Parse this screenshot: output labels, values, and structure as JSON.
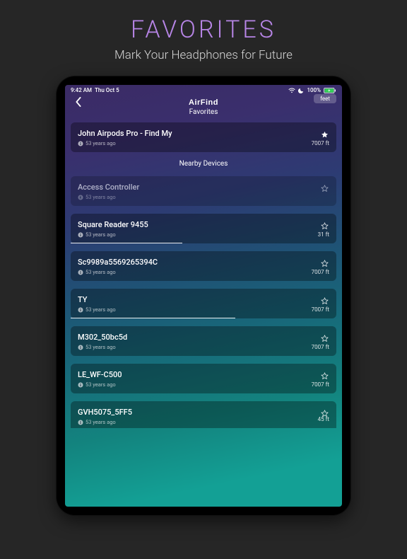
{
  "promo": {
    "title": "FAVORITES",
    "subtitle": "Mark Your Headphones for Future"
  },
  "status_bar": {
    "time": "9:42 AM",
    "date": "Thu Oct 5",
    "battery_pct": "100%"
  },
  "header": {
    "app_name": "AirFind",
    "page_title": "Favorites",
    "unit_toggle": "feet"
  },
  "favorites": [
    {
      "name": "John Airpods Pro - Find My",
      "ago": "53 years ago",
      "distance": "7007 ft",
      "starred": true,
      "progress_pct": 0
    }
  ],
  "nearby_label": "Nearby Devices",
  "nearby": [
    {
      "name": "Access Controller",
      "ago": "53 years ago",
      "distance": "",
      "starred": false,
      "dim": true,
      "progress_pct": 0
    },
    {
      "name": "Square Reader 9455",
      "ago": "53 years ago",
      "distance": "31 ft",
      "starred": false,
      "dim": false,
      "progress_pct": 42
    },
    {
      "name": "Sc9989a5569265394C",
      "ago": "53 years ago",
      "distance": "7007 ft",
      "starred": false,
      "dim": false,
      "progress_pct": 0
    },
    {
      "name": "TY",
      "ago": "53 years ago",
      "distance": "7007 ft",
      "starred": false,
      "dim": false,
      "progress_pct": 62
    },
    {
      "name": "M302_50bc5d",
      "ago": "53 years ago",
      "distance": "7007 ft",
      "starred": false,
      "dim": false,
      "progress_pct": 0
    },
    {
      "name": "LE_WF-C500",
      "ago": "53 years ago",
      "distance": "7007 ft",
      "starred": false,
      "dim": false,
      "progress_pct": 0
    },
    {
      "name": "GVH5075_5FF5",
      "ago": "53 years ago",
      "distance": "45 ft",
      "starred": false,
      "dim": false,
      "progress_pct": 0,
      "cut": true
    }
  ]
}
